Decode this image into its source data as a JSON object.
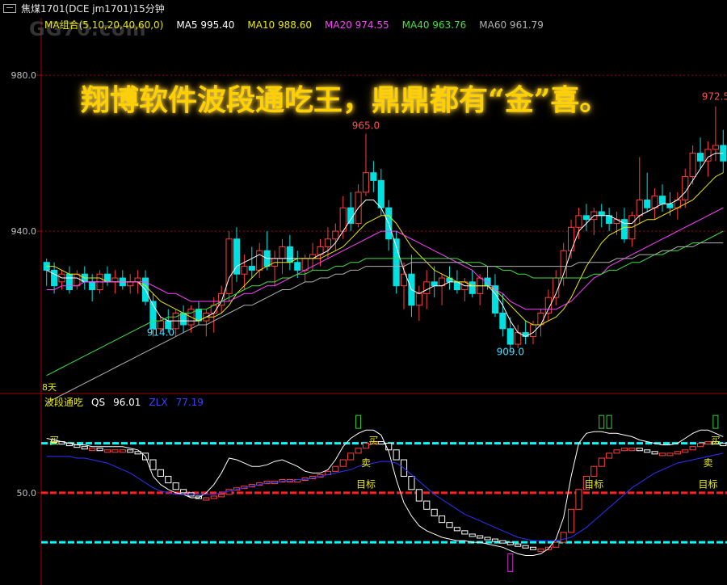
{
  "window": {
    "title": "焦煤1701(DCE jm1701)15分钟"
  },
  "watermark": "GG70.com",
  "banner": "翔博软件波段通吃王，鼎鼎都有“金”喜。",
  "ma_legend": {
    "group": "MA组合(5,10,20,40,60,0)",
    "ma5": "MA5 995.40",
    "ma10": "MA10 988.60",
    "ma20": "MA20 974.55",
    "ma40": "MA40 963.76",
    "ma60": "MA60 961.79",
    "colors": {
      "group": "#e8e800",
      "ma5": "#ffffff",
      "ma10": "#e8e800",
      "ma20": "#ff40ff",
      "ma40": "#40e040",
      "ma60": "#b0b0b0"
    }
  },
  "indicator_legend": {
    "name": "波段通吃",
    "qs": "QS",
    "qs_value": "96.01",
    "zlx": "ZLX",
    "zlx_value": "77.19",
    "colors": {
      "name": "#e8e800",
      "qs": "#ffffff",
      "zlx": "#4040ff"
    }
  },
  "annotations": {
    "hi1": "965.0",
    "hi2": "972.5",
    "lo1": "914.0",
    "lo2": "909.0",
    "days": "8天",
    "buy": "买",
    "sell": "卖",
    "target": "目标"
  },
  "chart_data": {
    "type": "candlestick",
    "title": "焦煤1701(DCE jm1701)15分钟",
    "price_axis": {
      "ticks": [
        980.0,
        940.0
      ],
      "labels": [
        "980.0",
        "940.0"
      ],
      "range": [
        899,
        991
      ]
    },
    "indicator_axis": {
      "ticks": [
        50.0
      ],
      "labels": [
        "50.0"
      ]
    },
    "indicator_levels": {
      "red": 50,
      "cyan_upper": 80,
      "cyan_lower": 20
    },
    "candles": [
      [
        932,
        933,
        926,
        930
      ],
      [
        930,
        932,
        924,
        926
      ],
      [
        927,
        930,
        925,
        929
      ],
      [
        929,
        931,
        924,
        925
      ],
      [
        926,
        930,
        925,
        929
      ],
      [
        929,
        931,
        925,
        927
      ],
      [
        927,
        929,
        922,
        925
      ],
      [
        925,
        930,
        924,
        929
      ],
      [
        929,
        931,
        926,
        927
      ],
      [
        927,
        930,
        924,
        928
      ],
      [
        928,
        930,
        925,
        926
      ],
      [
        926,
        929,
        924,
        927
      ],
      [
        927,
        930,
        924,
        928
      ],
      [
        928,
        930,
        921,
        922
      ],
      [
        922,
        924,
        913,
        915
      ],
      [
        915,
        918,
        914,
        917
      ],
      [
        917,
        920,
        914,
        915
      ],
      [
        915,
        920,
        913,
        919
      ],
      [
        919,
        921,
        914,
        916
      ],
      [
        916,
        921,
        914,
        920
      ],
      [
        920,
        922,
        916,
        917
      ],
      [
        917,
        920,
        913,
        919
      ],
      [
        919,
        923,
        914,
        921
      ],
      [
        921,
        926,
        919,
        924
      ],
      [
        924,
        940,
        922,
        938
      ],
      [
        938,
        941,
        927,
        929
      ],
      [
        929,
        934,
        925,
        931
      ],
      [
        931,
        936,
        928,
        930
      ],
      [
        930,
        937,
        928,
        935
      ],
      [
        935,
        940,
        930,
        931
      ],
      [
        931,
        935,
        926,
        933
      ],
      [
        933,
        938,
        929,
        936
      ],
      [
        936,
        939,
        930,
        932
      ],
      [
        932,
        935,
        928,
        930
      ],
      [
        930,
        934,
        927,
        933
      ],
      [
        933,
        937,
        930,
        934
      ],
      [
        934,
        938,
        931,
        936
      ],
      [
        936,
        941,
        933,
        938
      ],
      [
        938,
        942,
        935,
        940
      ],
      [
        940,
        949,
        938,
        946
      ],
      [
        946,
        950,
        940,
        942
      ],
      [
        942,
        952,
        941,
        950
      ],
      [
        950,
        965,
        949,
        955
      ],
      [
        955,
        958,
        950,
        953
      ],
      [
        953,
        956,
        944,
        946
      ],
      [
        946,
        948,
        935,
        938
      ],
      [
        938,
        940,
        924,
        926
      ],
      [
        926,
        932,
        920,
        929
      ],
      [
        929,
        934,
        918,
        921
      ],
      [
        921,
        926,
        917,
        924
      ],
      [
        924,
        930,
        920,
        927
      ],
      [
        927,
        931,
        923,
        926
      ],
      [
        926,
        929,
        921,
        928
      ],
      [
        928,
        931,
        925,
        927
      ],
      [
        927,
        930,
        924,
        925
      ],
      [
        925,
        928,
        922,
        927
      ],
      [
        927,
        930,
        923,
        924
      ],
      [
        924,
        929,
        921,
        928
      ],
      [
        928,
        931,
        925,
        926
      ],
      [
        926,
        929,
        918,
        919
      ],
      [
        919,
        924,
        913,
        915
      ],
      [
        915,
        918,
        909,
        911
      ],
      [
        911,
        916,
        910,
        914
      ],
      [
        914,
        917,
        911,
        913
      ],
      [
        913,
        917,
        911,
        916
      ],
      [
        916,
        920,
        913,
        919
      ],
      [
        919,
        925,
        917,
        923
      ],
      [
        923,
        930,
        921,
        928
      ],
      [
        928,
        937,
        926,
        935
      ],
      [
        935,
        943,
        933,
        941
      ],
      [
        941,
        946,
        938,
        944
      ],
      [
        944,
        947,
        940,
        943
      ],
      [
        943,
        946,
        939,
        945
      ],
      [
        945,
        947,
        941,
        944
      ],
      [
        944,
        946,
        940,
        942
      ],
      [
        942,
        945,
        939,
        943
      ],
      [
        943,
        946,
        937,
        938
      ],
      [
        938,
        945,
        936,
        944
      ],
      [
        944,
        959,
        942,
        948
      ],
      [
        948,
        955,
        945,
        946
      ],
      [
        946,
        951,
        943,
        949
      ],
      [
        949,
        952,
        945,
        947
      ],
      [
        947,
        950,
        944,
        946
      ],
      [
        946,
        950,
        943,
        948
      ],
      [
        948,
        956,
        946,
        954
      ],
      [
        954,
        962,
        952,
        960
      ],
      [
        960,
        964,
        956,
        958
      ],
      [
        958,
        963,
        954,
        961
      ],
      [
        961,
        972,
        958,
        962
      ],
      [
        962,
        966,
        955,
        958
      ]
    ],
    "series": [
      {
        "name": "MA5",
        "color": "#ffffff",
        "values": [
          930,
          929,
          928,
          928,
          928,
          927,
          927,
          927,
          927,
          927,
          927,
          927,
          927,
          925,
          921,
          918,
          917,
          917,
          917,
          917,
          917,
          918,
          919,
          922,
          928,
          931,
          932,
          933,
          934,
          933,
          933,
          933,
          933,
          933,
          933,
          933,
          934,
          935,
          937,
          940,
          943,
          946,
          948,
          948,
          946,
          942,
          936,
          930,
          925,
          924,
          925,
          926,
          926,
          927,
          927,
          926,
          926,
          926,
          926,
          924,
          921,
          917,
          914,
          913,
          914,
          916,
          920,
          924,
          929,
          935,
          940,
          942,
          944,
          944,
          944,
          943,
          942,
          942,
          944,
          945,
          946,
          947,
          947,
          948,
          950,
          953,
          956,
          959,
          960,
          960
        ]
      },
      {
        "name": "MA10",
        "color": "#e8e800",
        "values": [
          931,
          931,
          930,
          929,
          929,
          928,
          928,
          928,
          927,
          927,
          927,
          927,
          927,
          926,
          924,
          922,
          921,
          920,
          919,
          918,
          917,
          918,
          918,
          919,
          921,
          924,
          926,
          928,
          930,
          931,
          932,
          932,
          932,
          933,
          933,
          933,
          933,
          934,
          935,
          936,
          938,
          940,
          942,
          943,
          944,
          944,
          942,
          939,
          936,
          934,
          932,
          930,
          929,
          928,
          927,
          927,
          926,
          926,
          926,
          925,
          923,
          921,
          919,
          917,
          916,
          916,
          917,
          918,
          920,
          923,
          927,
          931,
          934,
          937,
          939,
          940,
          941,
          941,
          942,
          943,
          943,
          944,
          945,
          946,
          947,
          948,
          950,
          952,
          954,
          955
        ]
      },
      {
        "name": "MA20",
        "color": "#ff40ff",
        "values": [
          925,
          925,
          926,
          926,
          926,
          927,
          927,
          927,
          927,
          927,
          927,
          927,
          927,
          927,
          926,
          925,
          924,
          924,
          923,
          922,
          922,
          922,
          922,
          922,
          922,
          923,
          924,
          924,
          925,
          926,
          926,
          927,
          928,
          929,
          930,
          931,
          932,
          933,
          934,
          935,
          936,
          937,
          938,
          939,
          940,
          940,
          940,
          939,
          938,
          937,
          936,
          935,
          934,
          933,
          932,
          931,
          930,
          928,
          927,
          925,
          924,
          922,
          921,
          920,
          920,
          920,
          920,
          920,
          921,
          922,
          924,
          926,
          928,
          929,
          931,
          932,
          933,
          934,
          935,
          936,
          937,
          938,
          939,
          940,
          941,
          942,
          943,
          944,
          945,
          946
        ]
      },
      {
        "name": "MA40",
        "color": "#40e040",
        "values": [
          903,
          904,
          905,
          906,
          907,
          908,
          909,
          910,
          911,
          912,
          913,
          914,
          915,
          916,
          917,
          917,
          918,
          918,
          919,
          919,
          920,
          920,
          921,
          922,
          923,
          924,
          925,
          926,
          926,
          927,
          927,
          928,
          928,
          929,
          929,
          930,
          930,
          930,
          931,
          931,
          932,
          932,
          933,
          933,
          933,
          933,
          933,
          933,
          933,
          933,
          933,
          933,
          933,
          933,
          933,
          932,
          932,
          932,
          931,
          931,
          930,
          930,
          929,
          929,
          928,
          928,
          928,
          928,
          928,
          928,
          928,
          928,
          929,
          929,
          930,
          930,
          931,
          932,
          932,
          933,
          934,
          934,
          935,
          935,
          936,
          937,
          937,
          938,
          939,
          940
        ]
      },
      {
        "name": "MA60",
        "color": "#b0b0b0",
        "values": [
          896,
          897,
          898,
          899,
          900,
          901,
          902,
          903,
          904,
          905,
          906,
          907,
          908,
          909,
          910,
          911,
          912,
          913,
          914,
          915,
          916,
          916,
          917,
          918,
          919,
          920,
          921,
          921,
          922,
          923,
          924,
          925,
          925,
          926,
          927,
          927,
          928,
          928,
          929,
          929,
          930,
          930,
          931,
          931,
          931,
          931,
          931,
          931,
          932,
          932,
          932,
          932,
          932,
          932,
          932,
          932,
          931,
          931,
          931,
          931,
          931,
          931,
          931,
          931,
          931,
          931,
          931,
          931,
          931,
          931,
          932,
          932,
          932,
          932,
          932,
          933,
          933,
          933,
          934,
          934,
          934,
          935,
          935,
          936,
          936,
          936,
          937,
          937,
          937,
          937
        ]
      },
      {
        "name": "QS",
        "color": "#ffffff",
        "values": [
          83,
          82,
          81,
          80,
          79,
          79,
          78,
          78,
          78,
          78,
          78,
          77,
          76,
          72,
          60,
          55,
          52,
          50,
          49,
          47,
          47,
          50,
          55,
          62,
          71,
          70,
          68,
          66,
          66,
          67,
          69,
          70,
          68,
          66,
          63,
          62,
          62,
          64,
          70,
          78,
          83,
          86,
          88,
          88,
          85,
          75,
          58,
          44,
          36,
          30,
          27,
          25,
          23,
          22,
          21,
          21,
          20,
          20,
          19,
          18,
          17,
          15,
          13,
          12,
          12,
          13,
          16,
          22,
          35,
          60,
          80,
          86,
          87,
          87,
          86,
          86,
          85,
          84,
          82,
          81,
          80,
          79,
          79,
          80,
          83,
          86,
          88,
          88,
          86,
          84
        ]
      },
      {
        "name": "ZLX",
        "color": "#3030ff",
        "values": [
          72,
          72,
          72,
          72,
          71,
          71,
          70,
          69,
          68,
          66,
          64,
          62,
          59,
          56,
          53,
          51,
          50,
          49,
          49,
          49,
          49,
          49,
          49,
          50,
          51,
          52,
          53,
          54,
          55,
          56,
          56,
          57,
          57,
          58,
          58,
          59,
          60,
          61,
          62,
          63,
          64,
          66,
          67,
          68,
          69,
          69,
          68,
          65,
          61,
          57,
          53,
          49,
          46,
          43,
          40,
          37,
          35,
          33,
          31,
          29,
          27,
          25,
          23,
          22,
          21,
          21,
          21,
          21,
          22,
          23,
          26,
          29,
          33,
          37,
          41,
          45,
          49,
          53,
          56,
          59,
          62,
          64,
          66,
          68,
          69,
          70,
          71,
          72,
          73,
          74
        ]
      }
    ],
    "signal_bars": [
      82,
      81,
      80,
      79,
      78,
      77,
      77,
      76,
      76,
      76,
      76,
      75,
      74,
      70,
      64,
      60,
      56,
      52,
      50,
      48,
      47,
      47,
      48,
      49,
      52,
      53,
      54,
      55,
      56,
      57,
      57,
      58,
      58,
      58,
      59,
      60,
      61,
      63,
      66,
      70,
      74,
      77,
      80,
      81,
      80,
      76,
      70,
      60,
      52,
      45,
      40,
      36,
      32,
      29,
      27,
      25,
      24,
      23,
      22,
      21,
      20,
      19,
      18,
      17,
      16,
      16,
      17,
      20,
      26,
      40,
      52,
      60,
      66,
      71,
      74,
      76,
      77,
      77,
      76,
      75,
      74,
      74,
      74,
      75,
      76,
      78,
      80,
      81,
      80,
      79
    ]
  }
}
